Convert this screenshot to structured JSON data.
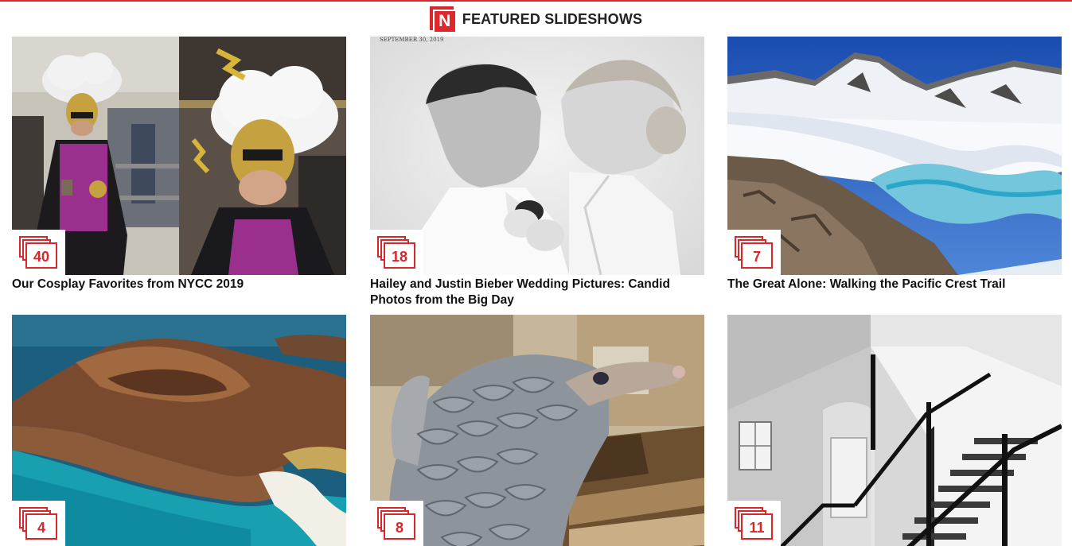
{
  "header": {
    "logo_letter": "N",
    "title": "FEATURED SLIDESHOWS"
  },
  "cards": [
    {
      "title": "Our Cosplay Favorites from NYCC 2019",
      "count": "40"
    },
    {
      "title": "Hailey and Justin Bieber Wedding Pictures: Candid Photos from the Big Day",
      "count": "18"
    },
    {
      "title": "The Great Alone: Walking the Pacific Crest Trail",
      "count": "7"
    },
    {
      "title": "",
      "count": "4"
    },
    {
      "title": "",
      "count": "8"
    },
    {
      "title": "",
      "count": "11"
    }
  ],
  "photo_date_text": "SEPTEMBER 30, 2019",
  "colors": {
    "accent": "#d9262b"
  }
}
